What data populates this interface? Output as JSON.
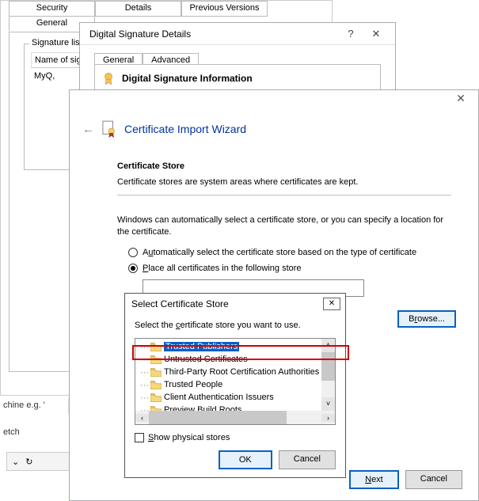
{
  "props": {
    "tabs_row1": [
      "Security",
      "Details",
      "Previous Versions"
    ],
    "tabs_row2_active": "General",
    "siglist_title": "Signature list",
    "sigtable_header": "Name of sig",
    "sigtable_value": "MyQ,"
  },
  "dsd": {
    "title": "Digital Signature Details",
    "help_glyph": "?",
    "close_glyph": "✕",
    "tab_general": "General",
    "tab_advanced": "Advanced",
    "info_heading": "Digital Signature Information"
  },
  "wizard": {
    "close_glyph": "✕",
    "back_glyph": "←",
    "title": "Certificate Import Wizard",
    "section_title": "Certificate Store",
    "section_desc": "Certificate stores are system areas where certificates are kept.",
    "paragraph": "Windows can automatically select a certificate store, or you can specify a location for the certificate.",
    "radio_auto_pre": "A",
    "radio_auto_ul": "u",
    "radio_auto_post": "tomatically select the certificate store based on the type of certificate",
    "radio_place_pre": "",
    "radio_place_ul": "P",
    "radio_place_post": "lace all certificates in the following store",
    "browse_pre": "B",
    "browse_ul": "r",
    "browse_post": "owse...",
    "next_pre": "",
    "next_ul": "N",
    "next_post": "ext",
    "cancel": "Cancel"
  },
  "scs": {
    "title": "Select Certificate Store",
    "close_glyph": "✕",
    "desc_pre": "Select the ",
    "desc_ul": "c",
    "desc_post": "ertificate store you want to use.",
    "tree": [
      "Trusted Publishers",
      "Untrusted Certificates",
      "Third-Party Root Certification Authorities",
      "Trusted People",
      "Client Authentication Issuers",
      "Preview Build Roots"
    ],
    "show_pre": "",
    "show_ul": "S",
    "show_post": "how physical stores",
    "ok": "OK",
    "cancel": "Cancel",
    "sb_up": "˄",
    "sb_down": "˅",
    "sb_left": "‹",
    "sb_right": "›"
  },
  "frag": {
    "machine": "chine e.g. '",
    "stretch": "etch",
    "chev": "⌄",
    "redo": "↻"
  }
}
